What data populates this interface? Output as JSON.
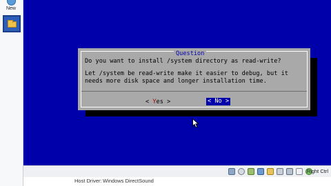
{
  "toolbar": {
    "new_label": "New"
  },
  "dialog": {
    "title": "Question",
    "question": "Do you want to install /system directory as read-write?",
    "detail_line1": "Let /system be read-write make it easier to debug, but it",
    "detail_line2": "needs more disk space and longer installation time.",
    "yes_prefix": "< ",
    "yes_hotkey": "Y",
    "yes_rest": "es >",
    "no_prefix": "< ",
    "no_hotkey": "N",
    "no_rest": "o >"
  },
  "status_bar": {
    "host_key_label": "Right Ctrl"
  },
  "details": {
    "host_driver_label": "Host Driver:",
    "host_driver_value": "Windows DirectSound"
  },
  "colors": {
    "console_background": "#0000aa",
    "dialog_background": "#a9a9a9",
    "selected_button": "#0000aa",
    "hotkey": "#aa0000"
  }
}
